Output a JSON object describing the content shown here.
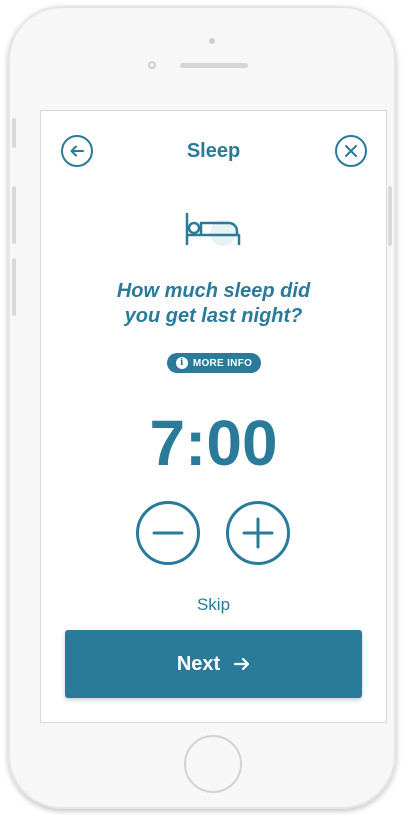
{
  "header": {
    "title": "Sleep"
  },
  "icons": {
    "back": "arrow-left-circle-icon",
    "close": "close-circle-icon",
    "bed": "bed-icon",
    "info": "info-icon",
    "minus": "minus-circle-icon",
    "plus": "plus-circle-icon",
    "next_arrow": "arrow-right-icon"
  },
  "question": {
    "line1": "How much sleep did",
    "line2": "you get last night?"
  },
  "more_info": {
    "label": "MORE INFO"
  },
  "time": {
    "value": "7:00"
  },
  "actions": {
    "skip_label": "Skip",
    "next_label": "Next"
  },
  "colors": {
    "accent": "#2a7a99",
    "background": "#ffffff",
    "button_text": "#ffffff"
  }
}
